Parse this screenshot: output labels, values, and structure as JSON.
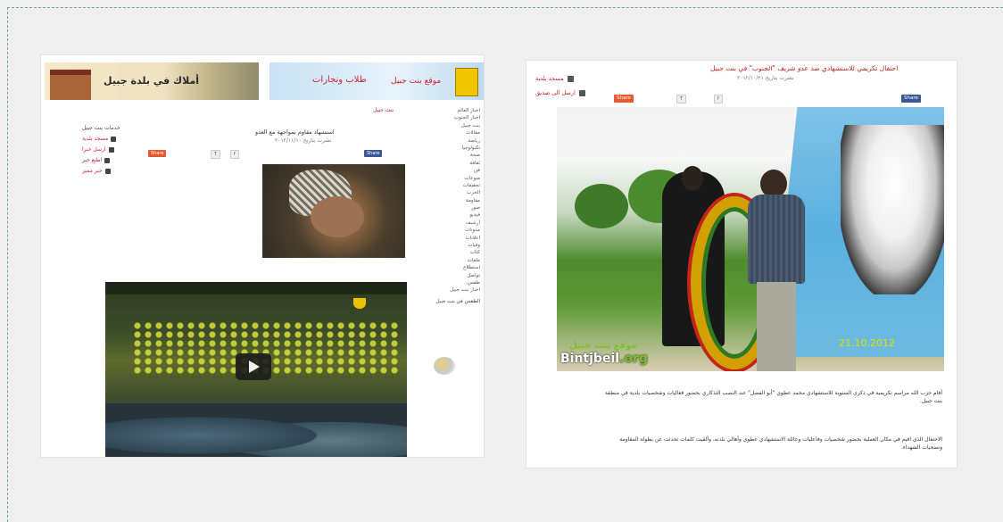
{
  "left": {
    "banner1_text": "أملاك في بلدة جبيل",
    "banner2_sub": "طلاب ونجارات",
    "banner2_site": "موقع بنت جبيل",
    "breadcrumb": "بنت جبيل",
    "article_title": "ﺍﺳﺘﺸﻬﺎﺩ ﻣﻘﺎﻭﻡ ﺑﻤﻮﺍﺟﻬﺔ ﻣﻊ ﺍﻟﻌﺪﻭ",
    "article_meta": "نشرت بتاريخ ٢٠١٢/١١/١٠",
    "side_heading": "خدمات بنت جبيل",
    "side_items": [
      "مسجد بلدية",
      "ارسل خبرا",
      "اطبع خبر",
      "خبر مميز"
    ],
    "share_count": "Share",
    "menu_items": [
      "اخبار العالم",
      "اخبار الجنوب",
      "بنت جبيل",
      "مقالات",
      "رياضة",
      "تكنولوجيا",
      "صحة",
      "ثقافة",
      "فن",
      "منوعات",
      "تحقيقات",
      "الحرب",
      "مقاومة",
      "صور",
      "فيديو",
      "أرشيف",
      "مدونات",
      "اعلانات",
      "وفيات",
      "كتاب",
      "ملفات",
      "استطلاع",
      "تواصل",
      "طقس",
      "اخبار بنت جبيل"
    ],
    "weather_label": "الطقس في بنت جبيل"
  },
  "right": {
    "title": "احتفال تكريمي للاستشهادي ضد عدو شريف \"الجنوب\" في بنت جبيل",
    "subtitle": "نشرت بتاريخ ٢٠١٢/١٠/٢١",
    "side_btn1": "مسجد بلدية",
    "side_btn2": "ارسل الى صديق",
    "share_label": "Share",
    "photo_date": "21.10.2012",
    "watermark_ar": "موقع بنت جبيل",
    "watermark_en": "Bintjbeil",
    "watermark_tld": ".org",
    "para1": "أقام حزب الله مراسم تكريمية في ذكرى السنوية للاستشهادي محمد عطوي \"أبو الفضل\" عند النصب التذكاري بحضور فعاليات وشخصيات بلدية في منطقة بنت جبيل.",
    "para2": "الاحتفال الذي اقيم في مكان العملية بحضور شخصيات وفاعليات وعائلة الاستشهادي عطوي وأهالي بلدته، وألقيت كلمات تحدثت عن بطولة المقاومة وتضحيات الشهداء."
  }
}
